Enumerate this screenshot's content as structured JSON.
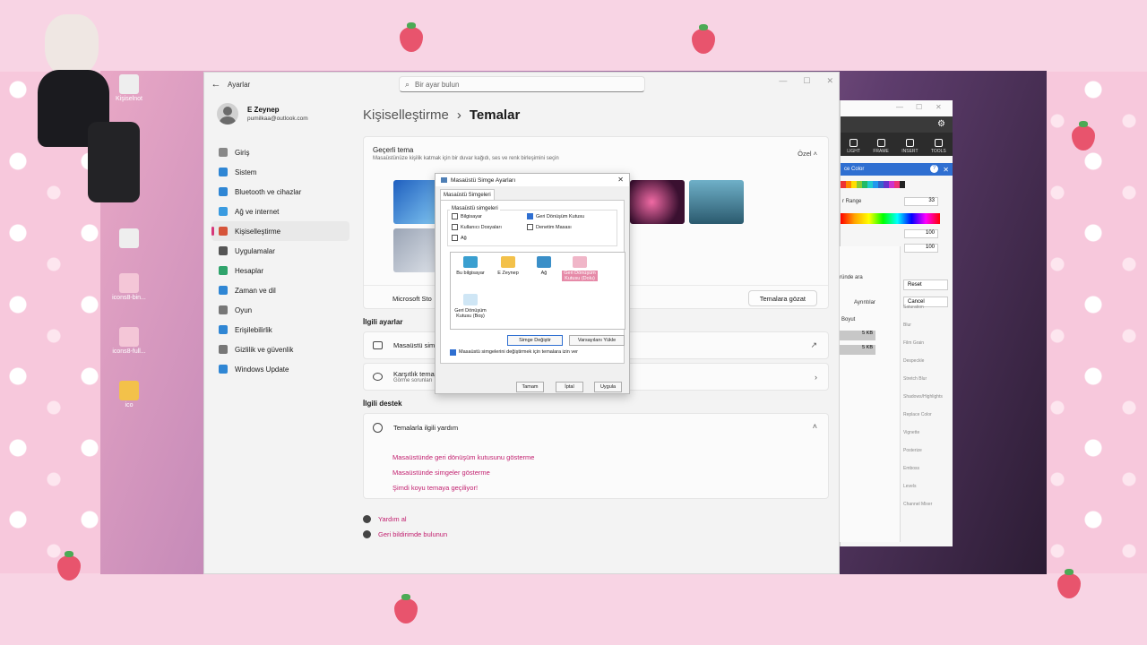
{
  "desktop": {
    "icons": [
      {
        "name": "notepad-file-icon",
        "label": "Kişiselnot",
        "type": "file"
      },
      {
        "name": "recycle-bin-icon",
        "label": "",
        "type": "file"
      },
      {
        "name": "bin-file-icon-1",
        "label": "icons8-bin...",
        "type": "bin"
      },
      {
        "name": "bin-file-icon-2",
        "label": "icons8-full...",
        "type": "bin"
      },
      {
        "name": "ico-folder-icon",
        "label": "ico",
        "type": "folder"
      }
    ]
  },
  "settings": {
    "app_title": "Ayarlar",
    "search_placeholder": "Bir ayar bulun",
    "user": {
      "name": "E Zeynep",
      "email": "pumilkaa@outlook.com"
    },
    "nav": [
      {
        "label": "Giriş",
        "icon": "home-icon",
        "color": "#888888"
      },
      {
        "label": "Sistem",
        "icon": "system-icon",
        "color": "#2f86d4"
      },
      {
        "label": "Bluetooth ve cihazlar",
        "icon": "bluetooth-icon",
        "color": "#2f86d4"
      },
      {
        "label": "Ağ ve internet",
        "icon": "network-icon",
        "color": "#3a9be0"
      },
      {
        "label": "Kişiselleştirme",
        "icon": "brush-icon",
        "color": "#d6543a"
      },
      {
        "label": "Uygulamalar",
        "icon": "apps-icon",
        "color": "#555555"
      },
      {
        "label": "Hesaplar",
        "icon": "accounts-icon",
        "color": "#2fa36b"
      },
      {
        "label": "Zaman ve dil",
        "icon": "time-language-icon",
        "color": "#2f86d4"
      },
      {
        "label": "Oyun",
        "icon": "gaming-icon",
        "color": "#777777"
      },
      {
        "label": "Erişilebilirlik",
        "icon": "accessibility-icon",
        "color": "#2f86d4"
      },
      {
        "label": "Gizlilik ve güvenlik",
        "icon": "shield-icon",
        "color": "#777777"
      },
      {
        "label": "Windows Update",
        "icon": "update-icon",
        "color": "#2f86d4"
      }
    ],
    "breadcrumb": {
      "parent": "Kişiselleştirme",
      "current": "Temalar"
    },
    "current_theme": {
      "title": "Geçerli tema",
      "description": "Masaüstünüze kişilik katmak için bir duvar kağıdı, ses ve renk birleşimini seçin",
      "value": "Özel"
    },
    "store_row": {
      "label": "Microsoft Sto",
      "button": "Temalara gözat"
    },
    "related_settings_title": "İlgili ayarlar",
    "related": [
      {
        "label": "Masaüstü sim",
        "end": "↗"
      },
      {
        "label": "Karşıtlık tema",
        "sub": "Görme sorunları",
        "end": "›"
      }
    ],
    "support_title": "İlgili destek",
    "help": {
      "title": "Temalarla ilgili yardım",
      "links": [
        "Masaüstünde geri dönüşüm kutusunu gösterme",
        "Masaüstünde simgeler gösterme",
        "Şimdi koyu temaya geçiliyor!"
      ]
    },
    "footer": [
      "Yardım al",
      "Geri bildirimde bulunun"
    ]
  },
  "dialog": {
    "title": "Masaüstü Simge Ayarları",
    "tab": "Masaüstü Simgeleri",
    "group_label": "Masaüstü simgeleri",
    "checkboxes": [
      {
        "label": "Bilgisayar",
        "checked": false
      },
      {
        "label": "Geri Dönüşüm Kutusu",
        "checked": true
      },
      {
        "label": "Kullanıcı Dosyaları",
        "checked": false
      },
      {
        "label": "Denetim Masası",
        "checked": false
      },
      {
        "label": "Ağ",
        "checked": false
      }
    ],
    "icons": [
      {
        "label": "Bu bilgisayar",
        "color": "#3a9fd0"
      },
      {
        "label": "E Zeynep",
        "color": "#f3c14a"
      },
      {
        "label": "Ağ",
        "color": "#3a8fc8"
      },
      {
        "label": "Geri Dönüşüm Kutusu (Dolu)",
        "color": "#f0b6c8"
      },
      {
        "label": "Geri Dönüşüm Kutusu (Boş)",
        "color": "#cfe6f5"
      }
    ],
    "change_icon": "Simge Değiştir",
    "restore_default": "Varsayılanı Yükle",
    "allow_themes": "Masaüstü simgelerini değiştirmek için temalara izin ver",
    "ok": "Tamam",
    "cancel": "İptal",
    "apply": "Uygula"
  },
  "paint": {
    "tools": [
      "LIGHT",
      "FRAME",
      "INSERT",
      "TOOLS"
    ],
    "color_panel_title": "ce Color",
    "range_label": "r Range",
    "values": [
      "33",
      "100",
      "100"
    ],
    "reset": "Reset",
    "cancel": "Cancel",
    "side_labels": [
      "Saturation",
      "Blur",
      "Film Grain",
      "Despeckle",
      "Stretch Blur",
      "Shadows/Highlights",
      "Replace Color",
      "Vignette",
      "Posterize",
      "Emboss",
      "Levels",
      "Channel Mixer"
    ]
  },
  "explorer_fragment": {
    "search_text": "ründe ara",
    "details": "Ayrıntılar",
    "column": "Boyut",
    "sizes": [
      "5 KB",
      "5 KB"
    ]
  }
}
